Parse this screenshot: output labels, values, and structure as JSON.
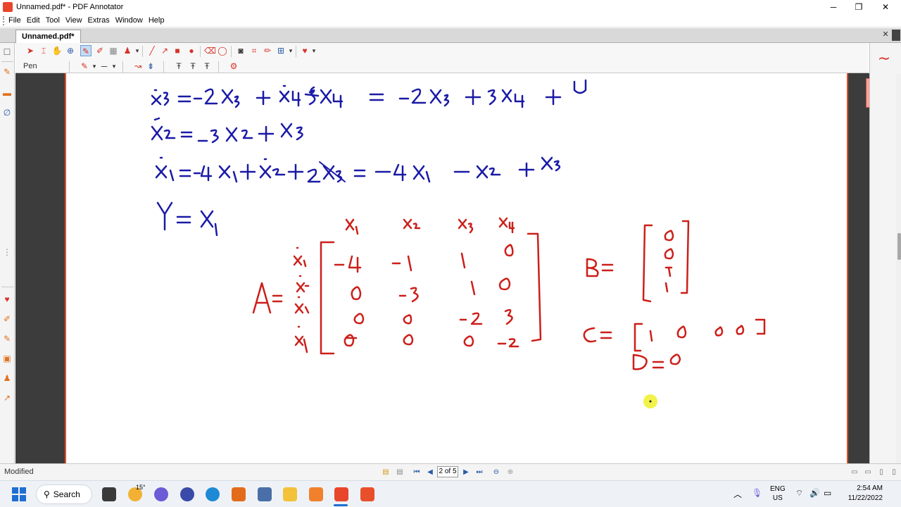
{
  "window": {
    "title": "Unnamed.pdf* - PDF Annotator",
    "minimize_glyph": "─",
    "restore_glyph": "❐",
    "close_glyph": "✕"
  },
  "menu": [
    "File",
    "Edit",
    "Tool",
    "View",
    "Extras",
    "Window",
    "Help"
  ],
  "tab": {
    "label": "Unnamed.pdf*",
    "close_glyph": "✕"
  },
  "toolbar": {
    "pen_label": "Pen"
  },
  "status": {
    "left_text": "Modified",
    "page_field": "2 of 5"
  },
  "taskbar": {
    "search_label": "Search",
    "weather": "15°",
    "language_line1": "ENG",
    "language_line2": "US",
    "time": "2:54 AM",
    "date": "11/22/2022"
  },
  "colors": {
    "ink_blue": "#1a1aa6",
    "ink_red": "#cc1f1a",
    "accent_orange": "#e0502c",
    "highlight_dot": "#f2f24a"
  },
  "page_content": {
    "handwritten_lines": [
      "ẋ3 = −2x3 + ẋ4 + 5x4 = −2x3 + 3x4 + u",
      "ẋ2 = −3x2 + x3",
      "ẋ1 = −4x1 + ẋ2 + 2x3 = −4x1 − x2 + x3",
      "Y = x1"
    ],
    "matrix_A": {
      "label": "A =",
      "col_headers": [
        "x1",
        "x2",
        "x3",
        "x4"
      ],
      "row_headers": [
        "ẋ1",
        "ẋ2",
        "ẋ3",
        "ẋ4"
      ],
      "rows": [
        [
          "−4",
          "−1",
          "1",
          "0"
        ],
        [
          "0",
          "−3",
          "1",
          "0"
        ],
        [
          "0",
          "0",
          "−2",
          "3"
        ],
        [
          "0",
          "0",
          "0",
          "−2"
        ]
      ]
    },
    "matrix_B": {
      "label": "B =",
      "values": [
        "0",
        "0",
        "1",
        "1"
      ]
    },
    "matrix_C": {
      "label": "C =",
      "values": [
        "1",
        "0",
        "0",
        "0"
      ]
    },
    "matrix_D": {
      "label": "D =",
      "value": "0"
    }
  }
}
